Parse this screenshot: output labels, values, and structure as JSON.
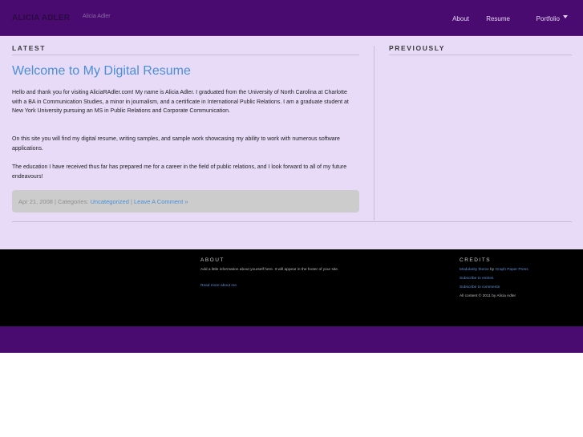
{
  "header": {
    "site_title": "ALICIA ADLER",
    "site_description": "Alicia Adler",
    "nav": {
      "about": "About",
      "resume": "Resume",
      "portfolio": "Portfolio"
    }
  },
  "main": {
    "latest_heading": "LATEST",
    "previously_heading": "PREVIOUSLY",
    "post": {
      "title": "Welcome to My Digital Resume",
      "paragraphs": [
        "Hello and thank you for visiting AliciaRAdler.com! My name is Alicia Adler. I graduated from the University of North Carolina at Charlotte with a BA in Communication Studies, a minor in journalism, and a certificate in International Public Relations. I am a graduate student at New York University pursuing an MS in Public Relations and Corporate Communication.",
        "On this site you will find my digital resume, writing samples, and sample work showcasing my ability to work with numerous software applications.",
        "The education I have received thus far has prepared me for a career in the field of public relations, and I look forward to all of my future endeavours!"
      ],
      "meta": {
        "date_prefix": "Apr 21, 2008 | Categories: ",
        "category": "Uncategorized",
        "separator": " | ",
        "comment_link": "Leave A Comment »"
      }
    }
  },
  "footer": {
    "about_heading": "ABOUT",
    "about_text": "Add a little information about yourself here. It will appear in the footer of your site.",
    "about_link": "Read more about me",
    "credits_heading": "CREDITS",
    "credits_theme_link": "Modularity theme",
    "credits_by": " by ",
    "credits_press_link": "Graph Paper Press",
    "subscribe_entries": "Subscribe to entries",
    "subscribe_comments": "Subscribe to comments",
    "copyright": "All content © 2011 by Alicia Adler"
  },
  "colors": {
    "brand_purple": "#4a0b71",
    "content_bg": "#e7dbf8",
    "link_blue": "#4b8fd6"
  }
}
